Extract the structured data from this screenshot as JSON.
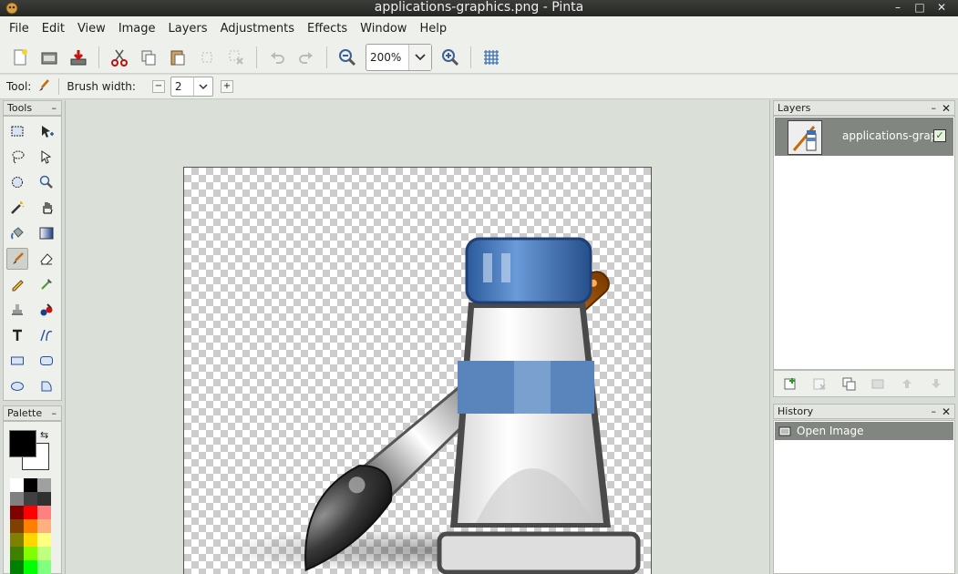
{
  "window": {
    "title": "applications-graphics.png - Pinta",
    "minimize_glyph": "–",
    "maximize_glyph": "□",
    "close_glyph": "✕"
  },
  "menu": [
    "File",
    "Edit",
    "View",
    "Image",
    "Layers",
    "Adjustments",
    "Effects",
    "Window",
    "Help"
  ],
  "toolbar": {
    "buttons": [
      "new-file-icon",
      "open-folder-icon",
      "save-icon",
      "cut-icon",
      "copy-icon",
      "paste-icon",
      "crop-icon",
      "deselect-icon",
      "undo-icon",
      "redo-icon",
      "zoom-out-icon",
      "zoom-in-icon",
      "grid-icon"
    ],
    "zoom_value": "200%"
  },
  "tool_options": {
    "tool_label": "Tool:",
    "brush_width_label": "Brush width:",
    "brush_width_value": "2",
    "minus": "−",
    "plus": "+"
  },
  "tools_panel": {
    "title": "Tools",
    "minimize": "–",
    "tools": [
      "rectangle-select",
      "move-selected",
      "lasso-select",
      "move-selection",
      "ellipse-select",
      "zoom",
      "magic-wand",
      "pan",
      "paint-bucket",
      "gradient",
      "paintbrush",
      "eraser",
      "pencil",
      "color-picker",
      "clone-stamp",
      "recolor",
      "text",
      "line-curve",
      "rectangle",
      "rounded-rectangle",
      "ellipse",
      "freeform-shape"
    ],
    "active_tool": "paintbrush"
  },
  "palette_panel": {
    "title": "Palette",
    "minimize": "–",
    "primary_color": "#000000",
    "secondary_color": "#ffffff",
    "swap_glyph": "⇆",
    "swatches": [
      "#ffffff",
      "#000000",
      "#a0a0a0",
      "#808080",
      "#404040",
      "#303030",
      "#800000",
      "#ff0000",
      "#ff8080",
      "#804000",
      "#ff8000",
      "#ffb080",
      "#808000",
      "#ffd700",
      "#ffff80",
      "#408000",
      "#80ff00",
      "#c0ff80",
      "#008000",
      "#00ff00",
      "#80ff80"
    ]
  },
  "layers_panel": {
    "title": "Layers",
    "minimize": "–",
    "close": "✕",
    "layers": [
      {
        "name": "applications-graphics",
        "visible": true
      }
    ],
    "check_glyph": "✓",
    "buttons": [
      "add-layer-icon",
      "delete-layer-icon",
      "duplicate-layer-icon",
      "merge-layer-icon",
      "move-layer-up-icon",
      "move-layer-down-icon"
    ]
  },
  "history_panel": {
    "title": "History",
    "minimize": "–",
    "close": "✕",
    "items": [
      "Open Image"
    ]
  },
  "colors": {
    "selection_gray": "#818680",
    "brush_orange": "#c86a0a",
    "cap_blue": "#3d6fb0"
  }
}
